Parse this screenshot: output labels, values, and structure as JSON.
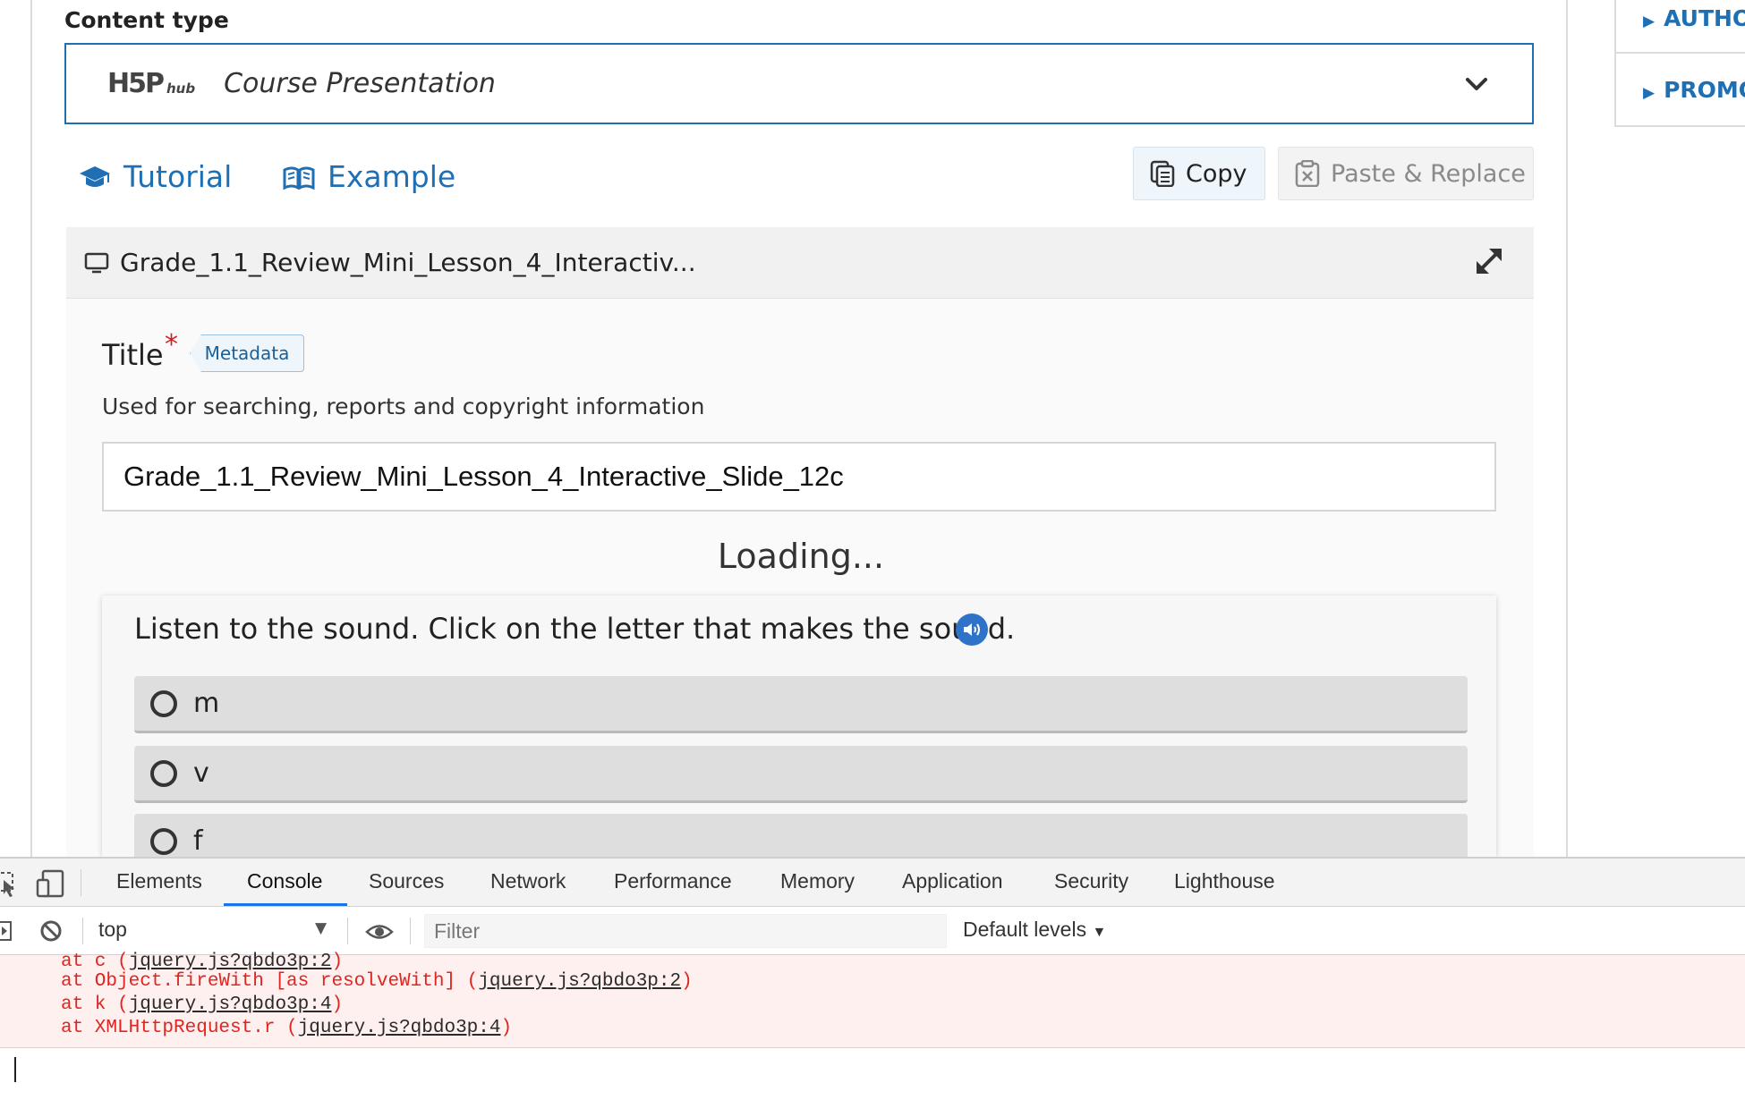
{
  "content_type": {
    "label": "Content type",
    "logo_text": "H5P",
    "logo_sub": "hub",
    "selected": "Course Presentation"
  },
  "links": {
    "tutorial": "Tutorial",
    "example": "Example"
  },
  "actions": {
    "copy": "Copy",
    "paste_replace": "Paste & Replace"
  },
  "editor_header": {
    "title": "Grade_1.1_Review_Mini_Lesson_4_Interactiv..."
  },
  "title_field": {
    "label": "Title",
    "required_mark": "*",
    "metadata_label": "Metadata",
    "description": "Used for searching, reports and copyright information",
    "value": "Grade_1.1_Review_Mini_Lesson_4_Interactive_Slide_12c"
  },
  "loading_text": "Loading...",
  "question": {
    "text": "Listen to the sound. Click on the letter that makes the sound.",
    "answers": [
      "m",
      "v",
      "f"
    ]
  },
  "sidebar": {
    "items": [
      "AUTHO",
      "PROMO"
    ]
  },
  "devtools": {
    "tabs": [
      "Elements",
      "Console",
      "Sources",
      "Network",
      "Performance",
      "Memory",
      "Application",
      "Security",
      "Lighthouse"
    ],
    "active_tab": "Console",
    "context": "top",
    "filter_placeholder": "Filter",
    "levels": "Default levels",
    "stack_lines": [
      {
        "prefix": "at c (",
        "link": "jquery.js?qbdo3p:2",
        "suffix": ")"
      },
      {
        "prefix": "at Object.fireWith [as resolveWith] (",
        "link": "jquery.js?qbdo3p:2",
        "suffix": ")"
      },
      {
        "prefix": "at k (",
        "link": "jquery.js?qbdo3p:4",
        "suffix": ")"
      },
      {
        "prefix": "at XMLHttpRequest.r (",
        "link": "jquery.js?qbdo3p:4",
        "suffix": ")"
      }
    ]
  },
  "colors": {
    "accent": "#1f6fb5",
    "error_text": "#e0251f",
    "error_bg": "#fff0f0",
    "required": "#cc2222"
  }
}
